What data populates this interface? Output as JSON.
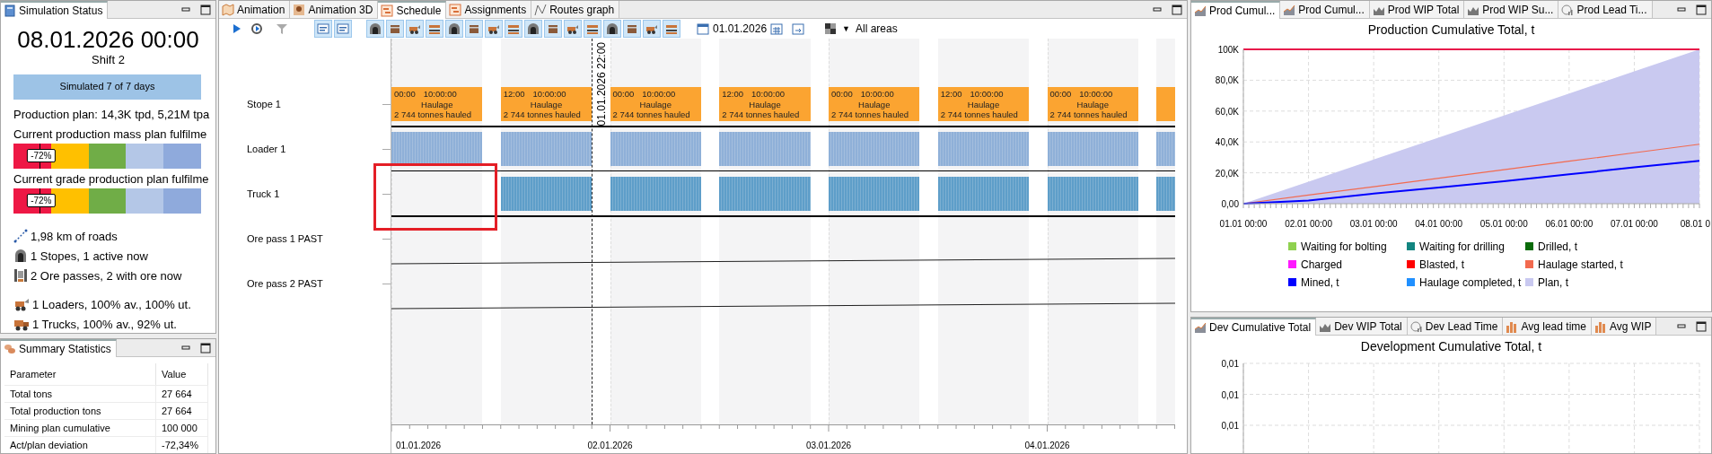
{
  "status_panel": {
    "tab": "Simulation Status",
    "datetime": "08.01.2026 00:00",
    "shift": "Shift 2",
    "progress": {
      "label": "Simulated 7 of 7 days"
    },
    "plan": "Production plan: 14,3K tpd, 5,21M tpa",
    "gauges": [
      {
        "label": "Current production mass plan fulfilme",
        "reading": "-72%"
      },
      {
        "label": "Current grade production plan fulfilme",
        "reading": "-72%"
      }
    ],
    "network": [
      {
        "kind": "road",
        "text": "1,98 km of roads"
      },
      {
        "kind": "stope",
        "text": "1 Stopes, 1 active now"
      },
      {
        "kind": "orepass",
        "text": "2 Ore passes, 2 with ore now"
      }
    ],
    "fleet": [
      {
        "kind": "loader",
        "text": "1 Loaders, 100% av., 100% ut."
      },
      {
        "kind": "truck",
        "text": "1 Trucks, 100% av., 92% ut."
      }
    ]
  },
  "summary_panel": {
    "tab": "Summary Statistics",
    "columns": [
      "Parameter",
      "Value"
    ],
    "rows": [
      [
        "Total tons",
        "27 664"
      ],
      [
        "Total production tons",
        "27 664"
      ],
      [
        "Mining plan cumulative",
        "100 000"
      ],
      [
        "Act/plan deviation",
        "-72,34%"
      ]
    ]
  },
  "schedule_panel": {
    "tabs": [
      {
        "label": "Animation",
        "kind": "map",
        "selected": false
      },
      {
        "label": "Animation 3D",
        "kind": "pin",
        "selected": false
      },
      {
        "label": "Schedule",
        "kind": "gantt",
        "selected": true
      },
      {
        "label": "Assignments",
        "kind": "gantt",
        "selected": false
      },
      {
        "label": "Routes graph",
        "kind": "graph",
        "selected": false
      }
    ],
    "toolbar": {
      "toggles": [
        {
          "on": true
        },
        {
          "on": true
        },
        {
          "on": true
        },
        {
          "on": true
        },
        {
          "on": true
        },
        {
          "on": true
        },
        {
          "on": true
        },
        {
          "on": true
        },
        {
          "on": true
        },
        {
          "on": true
        },
        {
          "on": true
        },
        {
          "on": true
        },
        {
          "on": true
        },
        {
          "on": true
        },
        {
          "on": true
        },
        {
          "on": true
        },
        {
          "on": true
        },
        {
          "on": true
        }
      ],
      "date": "01.01.2026",
      "area_caret": "▼",
      "area": "All areas"
    },
    "gantt": {
      "marker": "01.01.2026 22:00",
      "rows": [
        {
          "label": "Stope 1",
          "kind": "tasks",
          "bars": [
            {
              "kind": "full",
              "start": "00:00",
              "duration": "10:00:00",
              "title": "Haulage",
              "note": "2 744 tonnes hauled"
            },
            {
              "kind": "full",
              "start": "12:00",
              "duration": "10:00:00",
              "title": "Haulage",
              "note": "2 744 tonnes hauled"
            },
            {
              "kind": "full",
              "start": "00:00",
              "duration": "10:00:00",
              "title": "Haulage",
              "note": "2 744 tonnes hauled"
            },
            {
              "kind": "full",
              "start": "12:00",
              "duration": "10:00:00",
              "title": "Haulage",
              "note": "2 744 tonnes hauled"
            },
            {
              "kind": "full",
              "start": "00:00",
              "duration": "10:00:00",
              "title": "Haulage",
              "note": "2 744 tonnes hauled"
            },
            {
              "kind": "full",
              "start": "12:00",
              "duration": "10:00:00",
              "title": "Haulage",
              "note": "2 744 tonnes hauled"
            },
            {
              "kind": "full",
              "start": "00:00",
              "duration": "10:00:00",
              "title": "Haulage",
              "note": "2 744 tonnes hauled"
            },
            {
              "kind": "partial"
            }
          ]
        },
        {
          "label": "Loader 1",
          "kind": "activity",
          "shifts": [
            {
              "active": true
            },
            {
              "active": true
            },
            {
              "active": true
            },
            {
              "active": true
            },
            {
              "active": true
            },
            {
              "active": true
            },
            {
              "active": true
            },
            {
              "active": true
            }
          ]
        },
        {
          "label": "Truck 1",
          "kind": "activity",
          "shifts": [
            {
              "active": false
            },
            {
              "active": true
            },
            {
              "active": true
            },
            {
              "active": true
            },
            {
              "active": true
            },
            {
              "active": true
            },
            {
              "active": true
            },
            {
              "active": true
            }
          ]
        },
        {
          "label": "Ore pass 1 PAST",
          "kind": "level"
        },
        {
          "label": "Ore pass 2 PAST",
          "kind": "level"
        }
      ],
      "dates": [
        "01.01.2026",
        "02.01.2026",
        "03.01.2026",
        "04.01.2026"
      ]
    }
  },
  "production_panel": {
    "tabs": [
      {
        "label": "Prod Cumul...",
        "kind": "area",
        "selected": true
      },
      {
        "label": "Prod Cumul...",
        "kind": "area",
        "selected": false
      },
      {
        "label": "Prod WIP Total",
        "kind": "wip",
        "selected": false
      },
      {
        "label": "Prod WIP Su...",
        "kind": "wip",
        "selected": false
      },
      {
        "label": "Prod Lead Ti...",
        "kind": "clock",
        "selected": false
      }
    ],
    "chart_data": {
      "type": "line",
      "title": "Production Cumulative Total, t",
      "categories": [
        "01.01 00:00",
        "02.01 00:00",
        "03.01 00:00",
        "04.01 00:00",
        "05.01 00:00",
        "06.01 00:00",
        "07.01 00:00",
        "08.01 0"
      ],
      "ylim": [
        0,
        100000
      ],
      "yticks": [
        {
          "value": 0,
          "label": "0,00"
        },
        {
          "value": 20000,
          "label": "20,0K"
        },
        {
          "value": 40000,
          "label": "40,0K"
        },
        {
          "value": 60000,
          "label": "60,0K"
        },
        {
          "value": 80000,
          "label": "80,0K"
        },
        {
          "value": 100000,
          "label": "100K"
        }
      ],
      "series": [
        {
          "name": "Waiting for bolting",
          "color": "#8fd14f",
          "values": [
            null,
            null,
            null,
            null,
            null,
            null,
            null,
            null
          ]
        },
        {
          "name": "Waiting for drilling",
          "color": "#138580",
          "values": [
            null,
            null,
            null,
            null,
            null,
            null,
            null,
            null
          ]
        },
        {
          "name": "Drilled, t",
          "color": "#0a6b0a",
          "values": [
            null,
            null,
            null,
            null,
            null,
            null,
            null,
            null
          ]
        },
        {
          "name": "Charged",
          "color": "#ff19ff",
          "values": [
            null,
            null,
            null,
            null,
            null,
            null,
            null,
            null
          ]
        },
        {
          "name": "Blasted, t",
          "color": "#ff0000",
          "values": [
            null,
            null,
            null,
            null,
            null,
            null,
            null,
            null
          ]
        },
        {
          "name": "Haulage started, t",
          "color": "#f26a4f",
          "values": [
            0,
            5600,
            11000,
            16500,
            22000,
            27500,
            33000,
            38500
          ]
        },
        {
          "name": "Mined, t",
          "color": "#0000ff",
          "values": [
            0,
            2000,
            6500,
            10500,
            14500,
            19000,
            23500,
            27700
          ]
        },
        {
          "name": "Haulage completed, t",
          "color": "#2090ff",
          "values": [
            null,
            null,
            null,
            null,
            null,
            null,
            null,
            null
          ]
        },
        {
          "name": "Plan, t",
          "color": "#c9c9f0",
          "type": "area",
          "values": [
            0,
            14300,
            28600,
            42900,
            57100,
            71400,
            85700,
            100000
          ]
        }
      ],
      "grid": true
    }
  },
  "development_panel": {
    "tabs": [
      {
        "label": "Dev Cumulative Total",
        "kind": "area",
        "selected": true
      },
      {
        "label": "Dev WIP Total",
        "kind": "wip",
        "selected": false
      },
      {
        "label": "Dev Lead Time",
        "kind": "clock",
        "selected": false
      },
      {
        "label": "Avg lead time",
        "kind": "bars",
        "selected": false
      },
      {
        "label": "Avg WIP",
        "kind": "bars",
        "selected": false
      }
    ],
    "chart_data": {
      "type": "other",
      "title": "Development Cumulative Total, t"
    },
    "axis_labels": [
      "0,01",
      "0,01",
      "0,01"
    ]
  }
}
